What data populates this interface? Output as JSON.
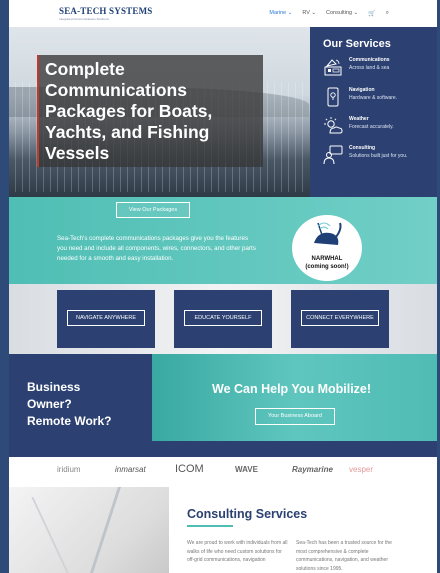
{
  "header": {
    "logo_title": "SEA-TECH SYSTEMS",
    "logo_tagline": "Integrated Communications Solutions",
    "nav": [
      {
        "label": "Marine ⌄",
        "active": true
      },
      {
        "label": "RV ⌄",
        "active": false
      },
      {
        "label": "Consulting ⌄",
        "active": false
      }
    ],
    "cart_icon": "🛒",
    "search_icon": "⌕"
  },
  "hero": {
    "title": "Complete Communications Packages for Boats, Yachts, and Fishing Vessels"
  },
  "services": {
    "title": "Our Services",
    "items": [
      {
        "name": "Communications",
        "desc": "Across land & sea",
        "icon": "satellite-dish-icon"
      },
      {
        "name": "Navigation",
        "desc": "Hardware & software.",
        "icon": "phone-map-icon"
      },
      {
        "name": "Weather",
        "desc": "Forecast accurately.",
        "icon": "sun-cloud-icon"
      },
      {
        "name": "Consulting",
        "desc": "Solutions built just for you.",
        "icon": "person-chat-icon"
      }
    ]
  },
  "packages": {
    "button": "View Our Packages",
    "text": "Sea-Tech's complete communications packages give you the features you need and include all components, wires, connectors, and other parts needed for a smooth and easy installation.",
    "narwhal_line1": "NARWHAL",
    "narwhal_line2": "(coming soon!)"
  },
  "cards": [
    {
      "label": "NAVIGATE ANYWHERE"
    },
    {
      "label": "EDUCATE YOURSELF"
    },
    {
      "label": "CONNECT EVERYWHERE"
    }
  ],
  "business": {
    "line1": "Business",
    "line2": "Owner?",
    "line3": "Remote Work?",
    "headline": "We Can Help You Mobilize!",
    "button": "Your Business Aboard"
  },
  "partners": [
    "iridium",
    "inmarsat",
    "ICOM",
    "WAVE",
    "Raymarine",
    "vesper"
  ],
  "consulting": {
    "title": "Consulting Services",
    "col1": "We are proud to work with individuals from all walks of life who need custom solutions for off-grid communications, navigation",
    "col2": "Sea-Tech has been a trusted source for the most comprehensive & complete communications, navigation, and weather solutions since 1995."
  },
  "colors": {
    "navy": "#2c4172",
    "teal": "#4fbeb4",
    "accent": "#2b7bd6"
  }
}
